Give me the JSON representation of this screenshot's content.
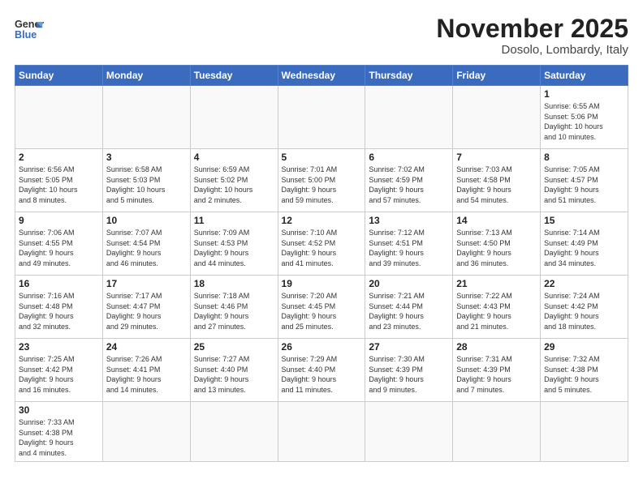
{
  "logo": {
    "line1": "General",
    "line2": "Blue"
  },
  "title": "November 2025",
  "location": "Dosolo, Lombardy, Italy",
  "weekdays": [
    "Sunday",
    "Monday",
    "Tuesday",
    "Wednesday",
    "Thursday",
    "Friday",
    "Saturday"
  ],
  "weeks": [
    [
      {
        "day": "",
        "info": ""
      },
      {
        "day": "",
        "info": ""
      },
      {
        "day": "",
        "info": ""
      },
      {
        "day": "",
        "info": ""
      },
      {
        "day": "",
        "info": ""
      },
      {
        "day": "",
        "info": ""
      },
      {
        "day": "1",
        "info": "Sunrise: 6:55 AM\nSunset: 5:06 PM\nDaylight: 10 hours\nand 10 minutes."
      }
    ],
    [
      {
        "day": "2",
        "info": "Sunrise: 6:56 AM\nSunset: 5:05 PM\nDaylight: 10 hours\nand 8 minutes."
      },
      {
        "day": "3",
        "info": "Sunrise: 6:58 AM\nSunset: 5:03 PM\nDaylight: 10 hours\nand 5 minutes."
      },
      {
        "day": "4",
        "info": "Sunrise: 6:59 AM\nSunset: 5:02 PM\nDaylight: 10 hours\nand 2 minutes."
      },
      {
        "day": "5",
        "info": "Sunrise: 7:01 AM\nSunset: 5:00 PM\nDaylight: 9 hours\nand 59 minutes."
      },
      {
        "day": "6",
        "info": "Sunrise: 7:02 AM\nSunset: 4:59 PM\nDaylight: 9 hours\nand 57 minutes."
      },
      {
        "day": "7",
        "info": "Sunrise: 7:03 AM\nSunset: 4:58 PM\nDaylight: 9 hours\nand 54 minutes."
      },
      {
        "day": "8",
        "info": "Sunrise: 7:05 AM\nSunset: 4:57 PM\nDaylight: 9 hours\nand 51 minutes."
      }
    ],
    [
      {
        "day": "9",
        "info": "Sunrise: 7:06 AM\nSunset: 4:55 PM\nDaylight: 9 hours\nand 49 minutes."
      },
      {
        "day": "10",
        "info": "Sunrise: 7:07 AM\nSunset: 4:54 PM\nDaylight: 9 hours\nand 46 minutes."
      },
      {
        "day": "11",
        "info": "Sunrise: 7:09 AM\nSunset: 4:53 PM\nDaylight: 9 hours\nand 44 minutes."
      },
      {
        "day": "12",
        "info": "Sunrise: 7:10 AM\nSunset: 4:52 PM\nDaylight: 9 hours\nand 41 minutes."
      },
      {
        "day": "13",
        "info": "Sunrise: 7:12 AM\nSunset: 4:51 PM\nDaylight: 9 hours\nand 39 minutes."
      },
      {
        "day": "14",
        "info": "Sunrise: 7:13 AM\nSunset: 4:50 PM\nDaylight: 9 hours\nand 36 minutes."
      },
      {
        "day": "15",
        "info": "Sunrise: 7:14 AM\nSunset: 4:49 PM\nDaylight: 9 hours\nand 34 minutes."
      }
    ],
    [
      {
        "day": "16",
        "info": "Sunrise: 7:16 AM\nSunset: 4:48 PM\nDaylight: 9 hours\nand 32 minutes."
      },
      {
        "day": "17",
        "info": "Sunrise: 7:17 AM\nSunset: 4:47 PM\nDaylight: 9 hours\nand 29 minutes."
      },
      {
        "day": "18",
        "info": "Sunrise: 7:18 AM\nSunset: 4:46 PM\nDaylight: 9 hours\nand 27 minutes."
      },
      {
        "day": "19",
        "info": "Sunrise: 7:20 AM\nSunset: 4:45 PM\nDaylight: 9 hours\nand 25 minutes."
      },
      {
        "day": "20",
        "info": "Sunrise: 7:21 AM\nSunset: 4:44 PM\nDaylight: 9 hours\nand 23 minutes."
      },
      {
        "day": "21",
        "info": "Sunrise: 7:22 AM\nSunset: 4:43 PM\nDaylight: 9 hours\nand 21 minutes."
      },
      {
        "day": "22",
        "info": "Sunrise: 7:24 AM\nSunset: 4:42 PM\nDaylight: 9 hours\nand 18 minutes."
      }
    ],
    [
      {
        "day": "23",
        "info": "Sunrise: 7:25 AM\nSunset: 4:42 PM\nDaylight: 9 hours\nand 16 minutes."
      },
      {
        "day": "24",
        "info": "Sunrise: 7:26 AM\nSunset: 4:41 PM\nDaylight: 9 hours\nand 14 minutes."
      },
      {
        "day": "25",
        "info": "Sunrise: 7:27 AM\nSunset: 4:40 PM\nDaylight: 9 hours\nand 13 minutes."
      },
      {
        "day": "26",
        "info": "Sunrise: 7:29 AM\nSunset: 4:40 PM\nDaylight: 9 hours\nand 11 minutes."
      },
      {
        "day": "27",
        "info": "Sunrise: 7:30 AM\nSunset: 4:39 PM\nDaylight: 9 hours\nand 9 minutes."
      },
      {
        "day": "28",
        "info": "Sunrise: 7:31 AM\nSunset: 4:39 PM\nDaylight: 9 hours\nand 7 minutes."
      },
      {
        "day": "29",
        "info": "Sunrise: 7:32 AM\nSunset: 4:38 PM\nDaylight: 9 hours\nand 5 minutes."
      }
    ],
    [
      {
        "day": "30",
        "info": "Sunrise: 7:33 AM\nSunset: 4:38 PM\nDaylight: 9 hours\nand 4 minutes."
      },
      {
        "day": "",
        "info": ""
      },
      {
        "day": "",
        "info": ""
      },
      {
        "day": "",
        "info": ""
      },
      {
        "day": "",
        "info": ""
      },
      {
        "day": "",
        "info": ""
      },
      {
        "day": "",
        "info": ""
      }
    ]
  ]
}
